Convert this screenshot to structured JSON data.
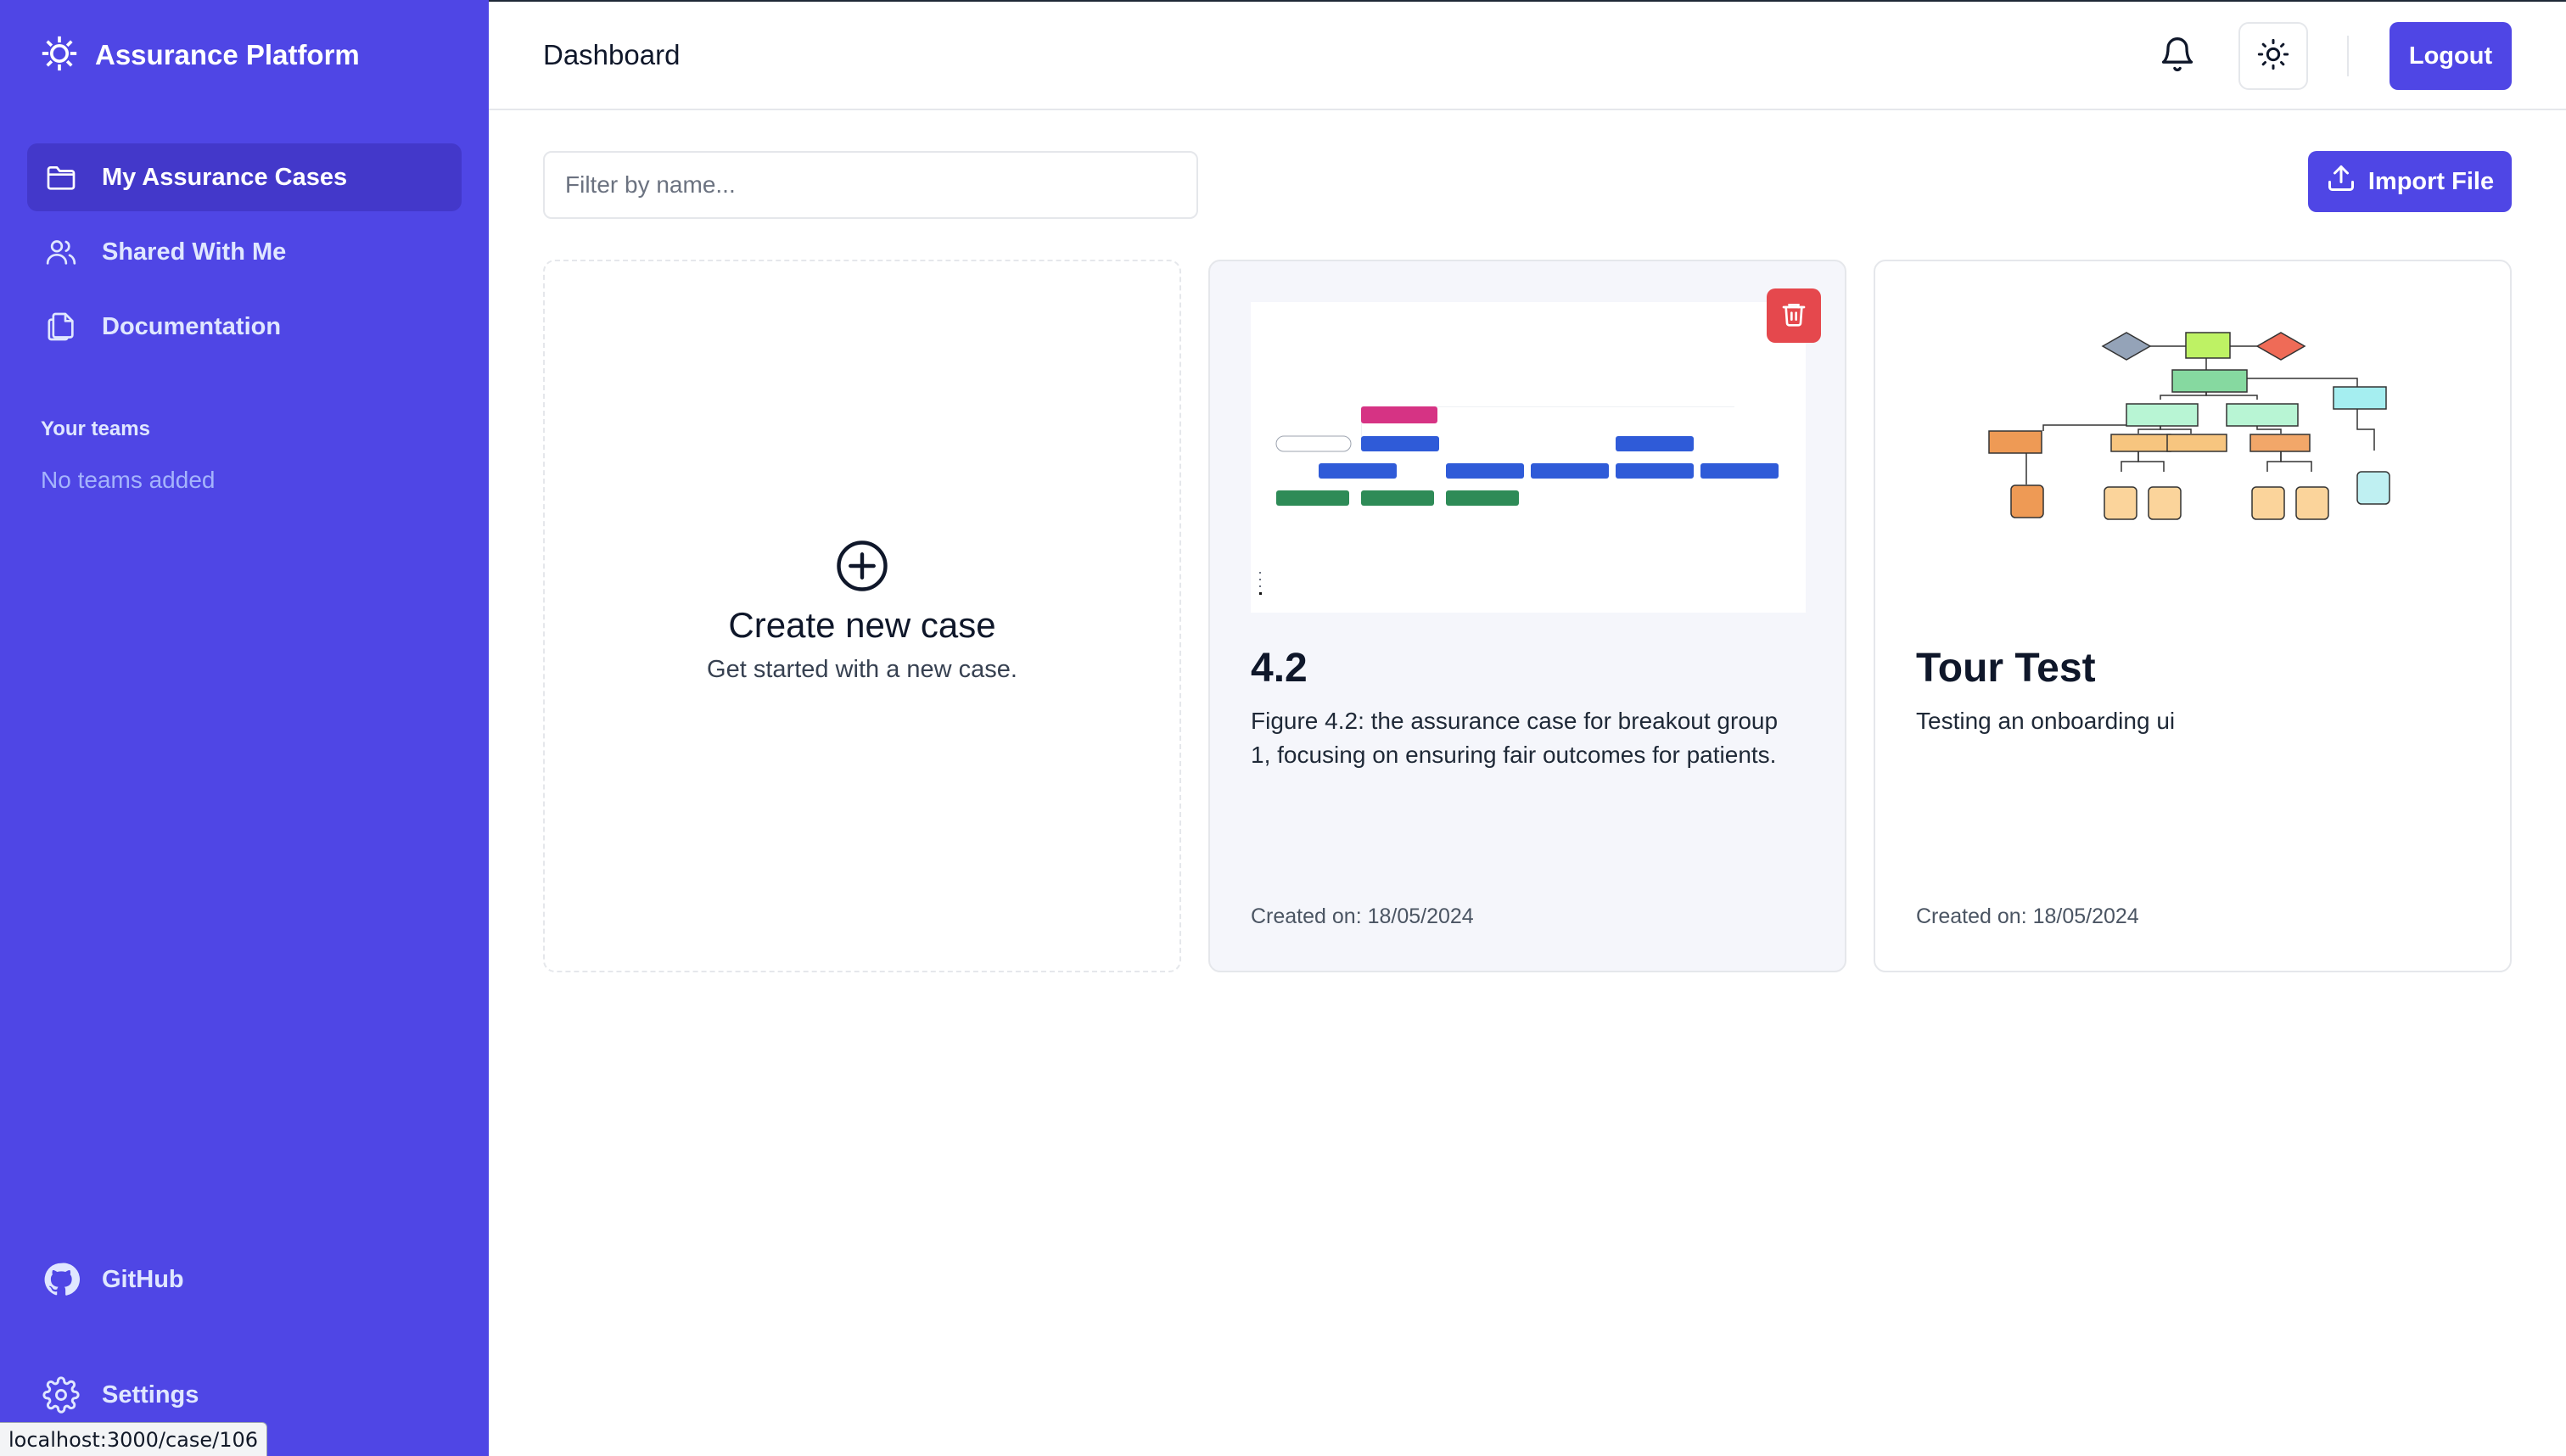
{
  "app": {
    "name": "Assurance Platform",
    "accent_color": "#4f46e5"
  },
  "sidebar": {
    "nav": [
      {
        "label": "My Assurance Cases",
        "icon": "folder-icon",
        "active": true
      },
      {
        "label": "Shared With Me",
        "icon": "users-icon",
        "active": false
      },
      {
        "label": "Documentation",
        "icon": "documents-icon",
        "active": false
      }
    ],
    "teams_title": "Your teams",
    "teams_empty": "No teams added",
    "github_label": "GitHub",
    "settings_label": "Settings"
  },
  "header": {
    "title": "Dashboard",
    "logout_label": "Logout"
  },
  "toolbar": {
    "filter_placeholder": "Filter by name...",
    "import_label": "Import File"
  },
  "create_card": {
    "title": "Create new case",
    "subtitle": "Get started with a new case."
  },
  "cases": [
    {
      "title": "4.2",
      "description": "Figure 4.2: the assurance case for breakout group 1, focusing on ensuring fair outcomes for patients.",
      "created": "Created on: 18/05/2024",
      "hovered": true
    },
    {
      "title": "Tour Test",
      "description": "Testing an onboarding ui",
      "created": "Created on: 18/05/2024",
      "hovered": false
    }
  ],
  "status_bar": {
    "url": "localhost:3000/case/106"
  }
}
